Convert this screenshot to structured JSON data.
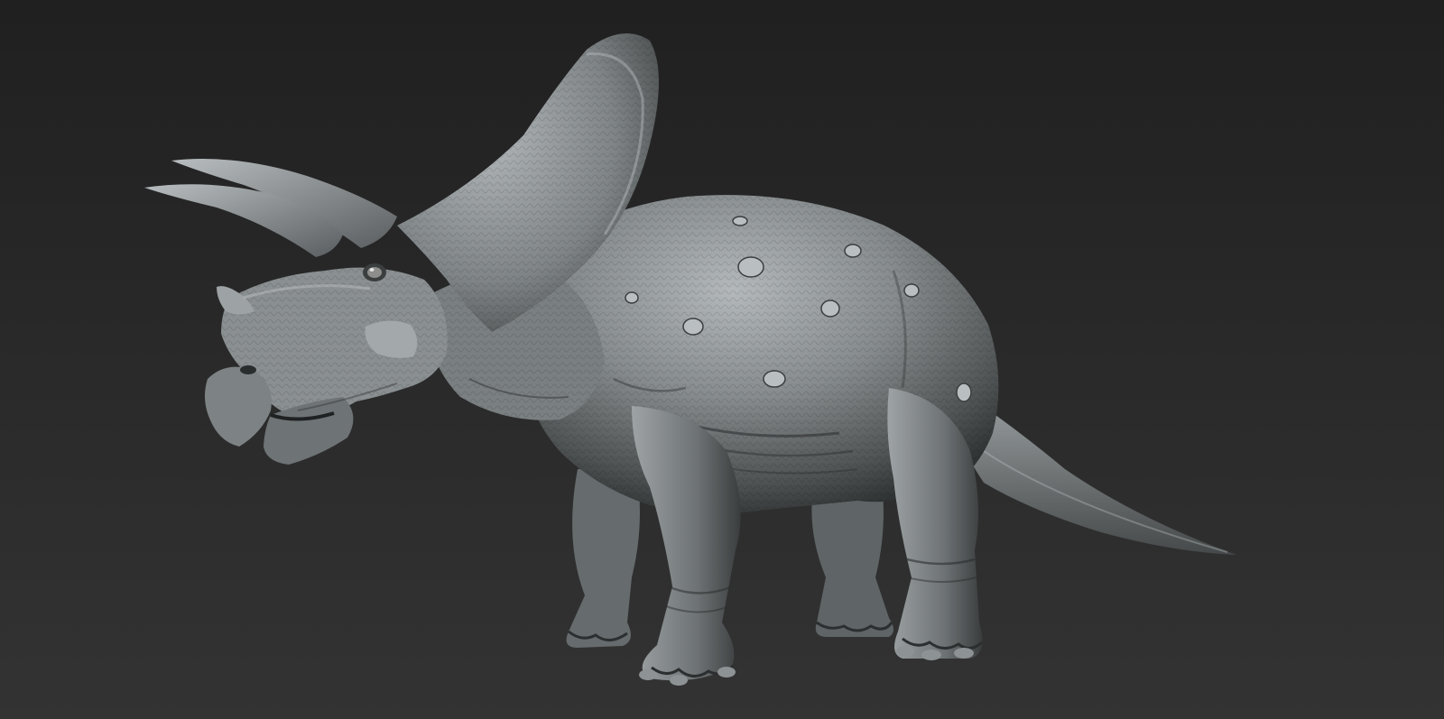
{
  "scene": {
    "subject": "triceratops-sculpt",
    "colors": {
      "background_top": "#202020",
      "background_bottom": "#333333",
      "clay_light": "#a9aeb0",
      "clay_mid": "#7c8183",
      "clay_dark": "#3f4344",
      "clay_shadow": "#1d1f20",
      "scale_highlight": "#c4c9cb"
    }
  }
}
